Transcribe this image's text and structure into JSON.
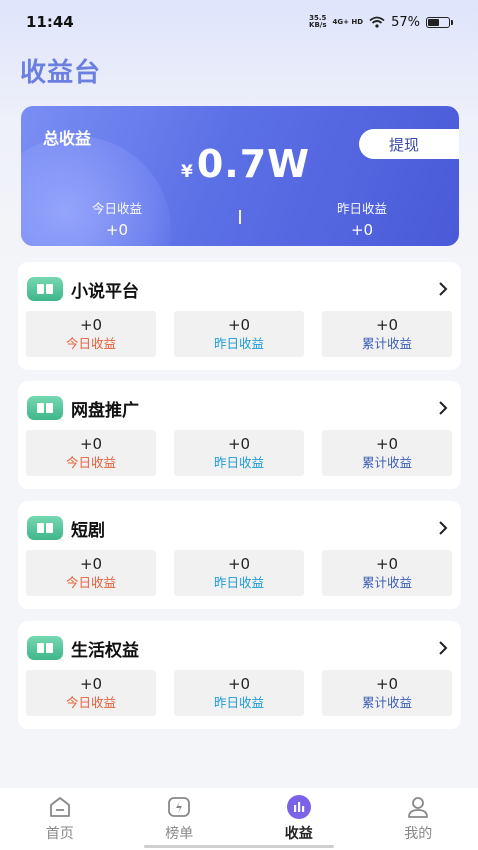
{
  "status_bar": {
    "time": "11:44",
    "net_speed_value": "35.5",
    "net_speed_unit": "KB/s",
    "signal": "4G+ HD",
    "battery": "57%"
  },
  "page_title": "收益台",
  "summary": {
    "label": "总收益",
    "withdraw_label": "提现",
    "currency": "¥",
    "amount": "0.7W",
    "today_label": "今日收益",
    "today_value": "+0",
    "yesterday_label": "昨日收益",
    "yesterday_value": "+0"
  },
  "platforms": [
    {
      "title": "小说平台",
      "stats": [
        {
          "value": "+0",
          "label": "今日收益"
        },
        {
          "value": "+0",
          "label": "昨日收益"
        },
        {
          "value": "+0",
          "label": "累计收益"
        }
      ]
    },
    {
      "title": "网盘推广",
      "stats": [
        {
          "value": "+0",
          "label": "今日收益"
        },
        {
          "value": "+0",
          "label": "昨日收益"
        },
        {
          "value": "+0",
          "label": "累计收益"
        }
      ]
    },
    {
      "title": "短剧",
      "stats": [
        {
          "value": "+0",
          "label": "今日收益"
        },
        {
          "value": "+0",
          "label": "昨日收益"
        },
        {
          "value": "+0",
          "label": "累计收益"
        }
      ]
    },
    {
      "title": "生活权益",
      "stats": [
        {
          "value": "+0",
          "label": "今日收益"
        },
        {
          "value": "+0",
          "label": "昨日收益"
        },
        {
          "value": "+0",
          "label": "累计收益"
        }
      ]
    }
  ],
  "tab_bar": {
    "tabs": [
      {
        "label": "首页",
        "icon": "home-icon"
      },
      {
        "label": "榜单",
        "icon": "ranking-icon"
      },
      {
        "label": "收益",
        "icon": "earnings-chart-icon",
        "active": true
      },
      {
        "label": "我的",
        "icon": "profile-icon"
      }
    ]
  },
  "colors": {
    "title": "#6b7fe0",
    "card_gradient_start": "#7a8ef4",
    "card_gradient_end": "#4a5ad8",
    "today": "#e8603c",
    "yesterday": "#1f9bd8",
    "total": "#3b5fb8",
    "active_tab": "#7b62e6",
    "badge": "#3fb68a"
  }
}
